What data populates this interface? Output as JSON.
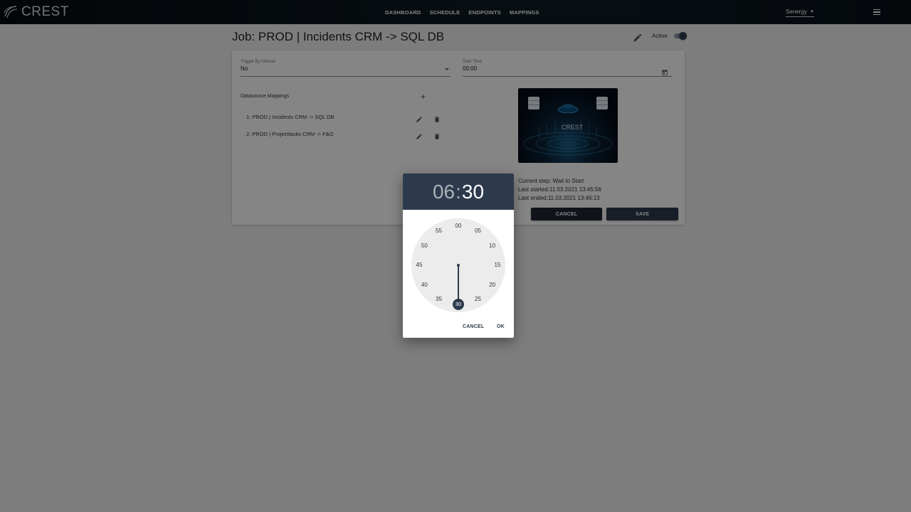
{
  "header": {
    "logo_text": "CREST",
    "nav": [
      "DASHBOARD",
      "SCHEDULE",
      "ENDPOINTS",
      "MAPPINGS"
    ],
    "tenant": "Senergy"
  },
  "page": {
    "title": "Job: PROD | Incidents CRM -> SQL DB",
    "active_label": "Active",
    "active": true
  },
  "form": {
    "trigger_label": "Trigger By Interval",
    "trigger_value": "No",
    "start_label": "Start Time",
    "start_value": "00:00",
    "mappings_label": "Datasource Mappings",
    "mappings": [
      "1: PROD | Incidents CRM -> SQL DB",
      "2: PROD | Projecttasks CRM -> F&O"
    ],
    "image_caption": "CREST",
    "status": {
      "current_step": "Current step: Wait to Start",
      "last_started": "Last started:11.03.2021 13:45:56",
      "last_ended": "Last ended:11.03.2021 13:46:13"
    },
    "cancel_label": "CANCEL",
    "save_label": "SAVE"
  },
  "time_picker": {
    "hours": "06",
    "separator": ":",
    "minutes": "30",
    "dial": [
      "00",
      "05",
      "10",
      "15",
      "20",
      "25",
      "30",
      "35",
      "40",
      "45",
      "50",
      "55"
    ],
    "selected_minute": "30",
    "cancel_label": "CANCEL",
    "ok_label": "OK"
  },
  "colors": {
    "topbar": "#0a1218",
    "accent": "#2d3a4d",
    "clock_face": "#ececec"
  }
}
